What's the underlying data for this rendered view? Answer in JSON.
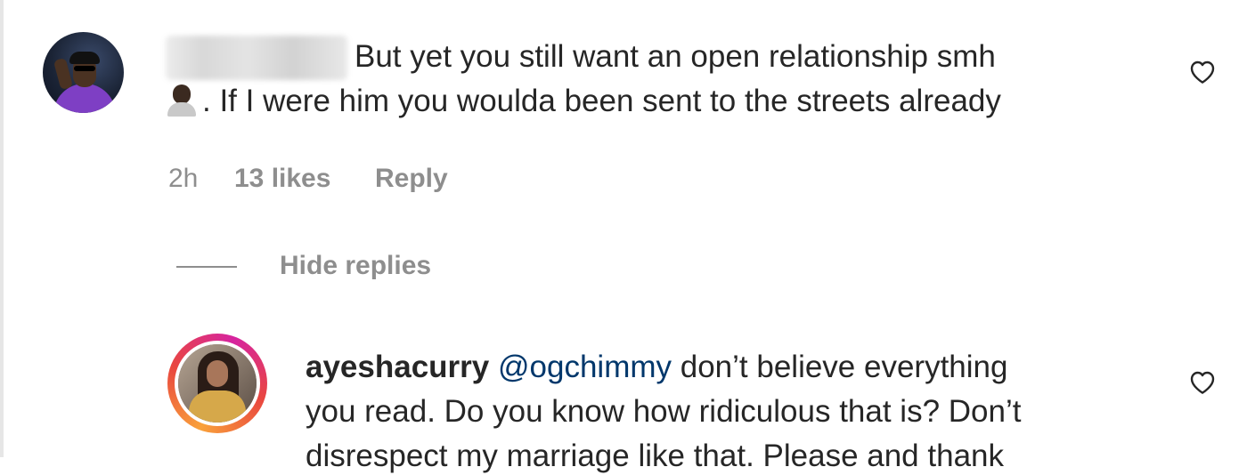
{
  "comment": {
    "text_line1": "But yet you still want an open relationship smh",
    "text_line2": ". If I were him you woulda been sent to the streets already",
    "time": "2h",
    "likes": "13 likes",
    "reply_label": "Reply",
    "emoji": "man-emoji"
  },
  "replies_toggle": {
    "label": "Hide replies"
  },
  "reply": {
    "username": "ayeshacurry",
    "mention": "@ogchimmy",
    "text_line1": " don’t believe everything",
    "text_line2": "you read. Do you know how ridiculous that is? Don’t",
    "text_line3": "disrespect my marriage like that. Please and thank"
  },
  "icons": {
    "like": "heart-outline-icon"
  },
  "colors": {
    "text": "#262626",
    "muted": "#8e8e8e",
    "mention": "#00376b"
  }
}
